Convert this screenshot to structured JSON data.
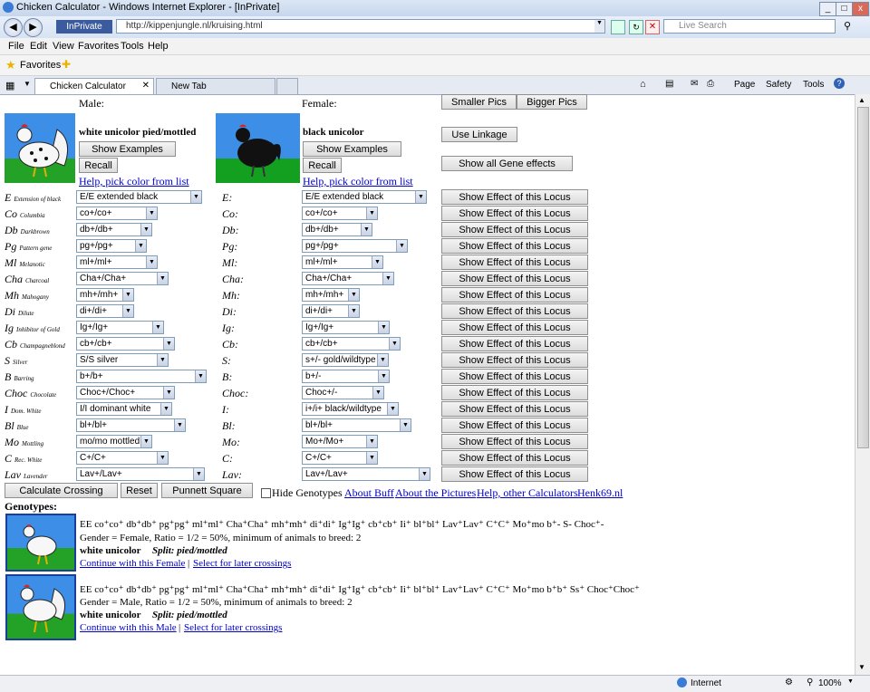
{
  "window": {
    "title": "Chicken Calculator - Windows Internet Explorer - [InPrivate]"
  },
  "address": {
    "inprivate": "InPrivate",
    "url": "http://kippenjungle.nl/kruising.html",
    "search_placeholder": "Live Search"
  },
  "menu": [
    "File",
    "Edit",
    "View",
    "Favorites",
    "Tools",
    "Help"
  ],
  "favbar": {
    "favorites": "Favorites"
  },
  "tabs": [
    {
      "label": "Chicken Calculator"
    },
    {
      "label": "New Tab"
    }
  ],
  "toolbar": {
    "page": "Page",
    "safety": "Safety",
    "tools": "Tools"
  },
  "page": {
    "male_label": "Male:",
    "female_label": "Female:",
    "smaller_pics": "Smaller Pics",
    "bigger_pics": "Bigger Pics",
    "use_linkage": "Use Linkage",
    "show_all": "Show all Gene effects",
    "male_color": "white unicolor pied/mottled",
    "female_color": "black unicolor",
    "show_examples": "Show Examples",
    "recall": "Recall",
    "help_pick": "Help, pick color from list",
    "show_effect": "Show Effect of this Locus"
  },
  "loci": [
    {
      "sym": "E",
      "name": "Extension of black",
      "f": "E:",
      "m": "E/E extended black",
      "fv": "E/E extended black"
    },
    {
      "sym": "Co",
      "name": "Columbia",
      "f": "Co:",
      "m": "co+/co+",
      "fv": "co+/co+"
    },
    {
      "sym": "Db",
      "name": "Darkbrown",
      "f": "Db:",
      "m": "db+/db+",
      "fv": "db+/db+"
    },
    {
      "sym": "Pg",
      "name": "Pattern gene",
      "f": "Pg:",
      "m": "pg+/pg+",
      "fv": "pg+/pg+"
    },
    {
      "sym": "Ml",
      "name": "Melanotic",
      "f": "Ml:",
      "m": "ml+/ml+",
      "fv": "ml+/ml+"
    },
    {
      "sym": "Cha",
      "name": "Charcoal",
      "f": "Cha:",
      "m": "Cha+/Cha+",
      "fv": "Cha+/Cha+"
    },
    {
      "sym": "Mh",
      "name": "Mahogany",
      "f": "Mh:",
      "m": "mh+/mh+",
      "fv": "mh+/mh+"
    },
    {
      "sym": "Di",
      "name": "Dilute",
      "f": "Di:",
      "m": "di+/di+",
      "fv": "di+/di+"
    },
    {
      "sym": "Ig",
      "name": "Inhibitor of Gold",
      "f": "Ig:",
      "m": "Ig+/Ig+",
      "fv": "Ig+/Ig+"
    },
    {
      "sym": "Cb",
      "name": "Champagneblond",
      "f": "Cb:",
      "m": "cb+/cb+",
      "fv": "cb+/cb+"
    },
    {
      "sym": "S",
      "name": "Silver",
      "f": "S:",
      "m": "S/S silver",
      "fv": "s+/- gold/wildtype"
    },
    {
      "sym": "B",
      "name": "Barring",
      "f": "B:",
      "m": "b+/b+",
      "fv": "b+/-"
    },
    {
      "sym": "Choc",
      "name": "Chocolate",
      "f": "Choc:",
      "m": "Choc+/Choc+",
      "fv": "Choc+/-"
    },
    {
      "sym": "I",
      "name": "Dom. White",
      "f": "I:",
      "m": "I/I dominant white",
      "fv": "i+/i+ black/wildtype"
    },
    {
      "sym": "Bl",
      "name": "Blue",
      "f": "Bl:",
      "m": "bl+/bl+",
      "fv": "bl+/bl+"
    },
    {
      "sym": "Mo",
      "name": "Mottling",
      "f": "Mo:",
      "m": "mo/mo mottled",
      "fv": "Mo+/Mo+"
    },
    {
      "sym": "C",
      "name": "Rec. White",
      "f": "C:",
      "m": "C+/C+",
      "fv": "C+/C+"
    },
    {
      "sym": "Lav",
      "name": "Lavender",
      "f": "Lav:",
      "m": "Lav+/Lav+",
      "fv": "Lav+/Lav+"
    }
  ],
  "actions": {
    "calc": "Calculate Crossing",
    "reset": "Reset",
    "punnett": "Punnett Square",
    "hide": "Hide Genotypes",
    "buff": "About Buff",
    "pictures": "About the Pictures",
    "help_other": "Help, other Calculators",
    "henk": "Henk69.nl"
  },
  "genotypes_heading": "Genotypes:",
  "results": [
    {
      "genotype": "EE co⁺co⁺ db⁺db⁺ pg⁺pg⁺ ml⁺ml⁺ Cha⁺Cha⁺ mh⁺mh⁺ di⁺di⁺ Ig⁺Ig⁺ cb⁺cb⁺ Ii⁺ bl⁺bl⁺ Lav⁺Lav⁺ C⁺C⁺ Mo⁺mo b⁺- S- Choc⁺-",
      "gender": "Gender = Female, Ratio = 1/2 = 50%, minimum of animals to breed: 2",
      "color": "white unicolor",
      "split": "Split: pied/mottled",
      "continue": "Continue with this Female",
      "select": "Select for later crossings"
    },
    {
      "genotype": "EE co⁺co⁺ db⁺db⁺ pg⁺pg⁺ ml⁺ml⁺ Cha⁺Cha⁺ mh⁺mh⁺ di⁺di⁺ Ig⁺Ig⁺ cb⁺cb⁺ Ii⁺ bl⁺bl⁺ Lav⁺Lav⁺ C⁺C⁺ Mo⁺mo b⁺b⁺ Ss⁺ Choc⁺Choc⁺",
      "gender": "Gender = Male, Ratio = 1/2 = 50%, minimum of animals to breed: 2",
      "color": "white unicolor",
      "split": "Split: pied/mottled",
      "continue": "Continue with this Male",
      "select": "Select for later crossings"
    }
  ],
  "status": {
    "zone": "Internet",
    "zoom": "100%"
  }
}
